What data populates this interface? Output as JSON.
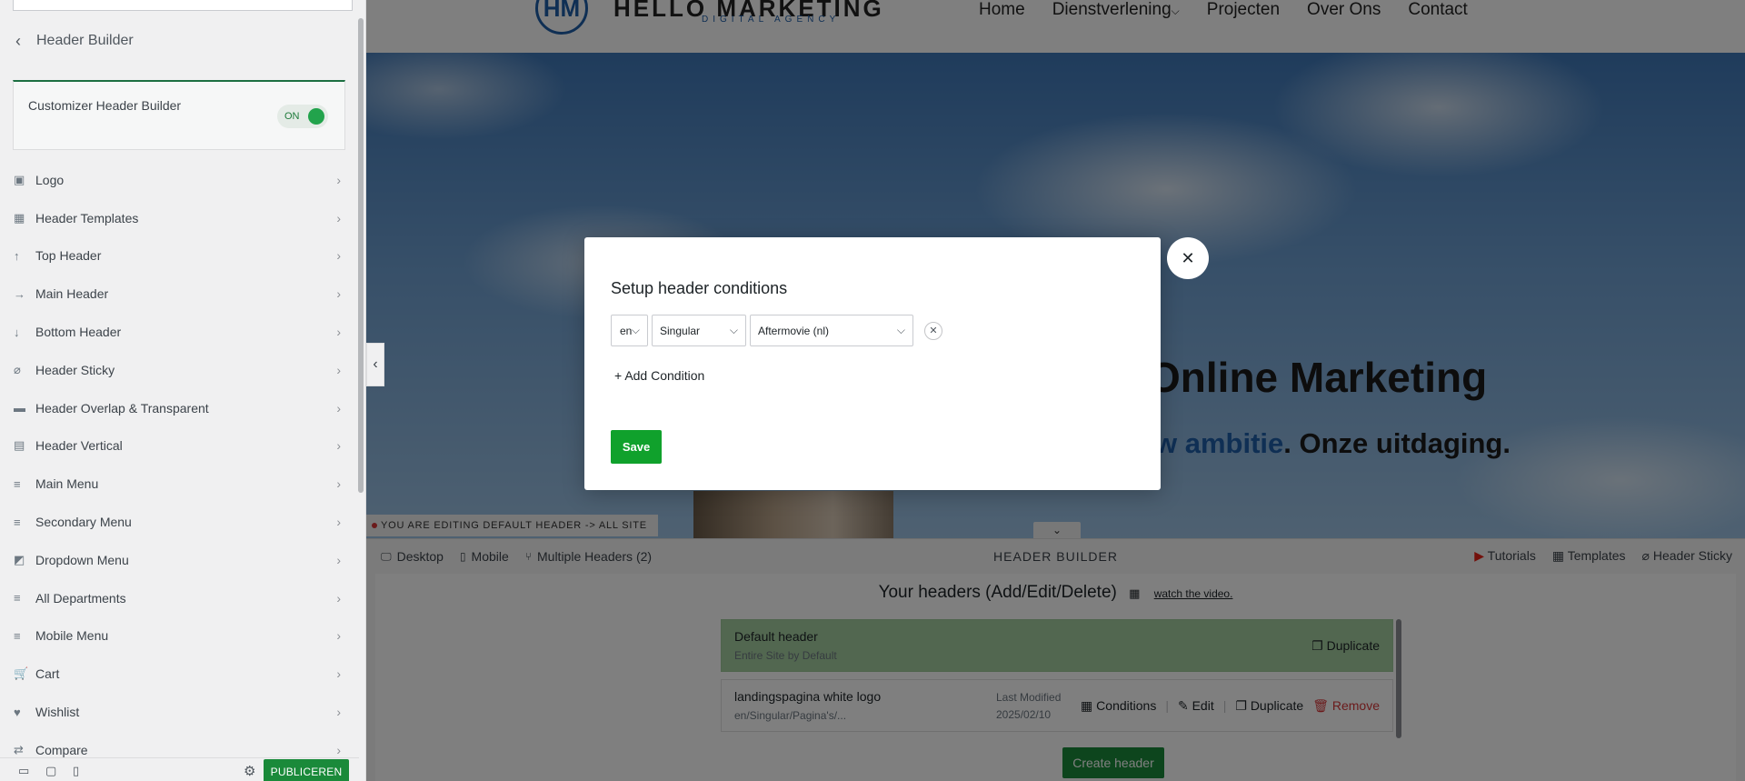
{
  "sidebar": {
    "back_title": "Header Builder",
    "toggle": {
      "label": "Customizer Header Builder",
      "state": "ON"
    },
    "items": [
      {
        "label": "Logo",
        "icon": "image-icon",
        "glyph": "▣"
      },
      {
        "label": "Header Templates",
        "icon": "grid-icon",
        "glyph": "▦"
      },
      {
        "label": "Top Header",
        "icon": "arrow-up-icon",
        "glyph": "↑"
      },
      {
        "label": "Main Header",
        "icon": "arrow-right-icon",
        "glyph": "→"
      },
      {
        "label": "Bottom Header",
        "icon": "arrow-down-icon",
        "glyph": "↓"
      },
      {
        "label": "Header Sticky",
        "icon": "paperclip-icon",
        "glyph": "⌀"
      },
      {
        "label": "Header Overlap & Transparent",
        "icon": "layers-icon",
        "glyph": "▬"
      },
      {
        "label": "Header Vertical",
        "icon": "document-icon",
        "glyph": "▤"
      },
      {
        "label": "Main Menu",
        "icon": "menu-icon",
        "glyph": "≡"
      },
      {
        "label": "Secondary Menu",
        "icon": "menu-icon",
        "glyph": "≡"
      },
      {
        "label": "Dropdown Menu",
        "icon": "dropdown-icon",
        "glyph": "◩"
      },
      {
        "label": "All Departments",
        "icon": "menu-icon",
        "glyph": "≡"
      },
      {
        "label": "Mobile Menu",
        "icon": "menu-icon",
        "glyph": "≡"
      },
      {
        "label": "Cart",
        "icon": "cart-icon",
        "glyph": "🛒"
      },
      {
        "label": "Wishlist",
        "icon": "heart-icon",
        "glyph": "♥"
      },
      {
        "label": "Compare",
        "icon": "compare-icon",
        "glyph": "⇄"
      }
    ],
    "footer": {
      "publish_label": "PUBLICEREN"
    }
  },
  "site": {
    "logo_mark": "HM",
    "logo_text": "HELLO MARKETING",
    "logo_sub": "DIGITAL AGENCY",
    "nav": [
      "Home",
      "Dienstverlening",
      "Projecten",
      "Over Ons",
      "Contact"
    ],
    "nav_dropdown_marker": "⌵",
    "hero_title": "Online Marketing",
    "hero_sub_accent": "w ambitie",
    "hero_sub_rest": ". Onze uitdaging."
  },
  "editing_notice": "YOU ARE EDITING DEFAULT HEADER -> ALL SITE",
  "builder": {
    "tabs": [
      {
        "label": "Desktop",
        "icon": "desktop-icon",
        "glyph": "🖵"
      },
      {
        "label": "Mobile",
        "icon": "mobile-icon",
        "glyph": "▯"
      },
      {
        "label": "Multiple Headers (2)",
        "icon": "branch-icon",
        "glyph": "⑂"
      }
    ],
    "title": "HEADER BUILDER",
    "links": [
      {
        "label": "Tutorials",
        "icon": "youtube-icon",
        "glyph": "▶"
      },
      {
        "label": "Templates",
        "icon": "grid-icon",
        "glyph": "▦"
      },
      {
        "label": "Header Sticky",
        "icon": "paperclip-icon",
        "glyph": "⌀"
      }
    ],
    "heading": "Your headers (Add/Edit/Delete)",
    "watch_link": "watch the video.",
    "headers": [
      {
        "name": "Default header",
        "sub": "Entire Site by Default",
        "duplicate": "Duplicate"
      },
      {
        "name": "landingspagina white logo",
        "sub": "en/Singular/Pagina's/...",
        "modified_label": "Last Modified",
        "modified_date": "2025/02/10",
        "conditions": "Conditions",
        "edit": "Edit",
        "duplicate": "Duplicate",
        "remove": "Remove"
      }
    ],
    "create_label": "Create header"
  },
  "modal": {
    "title": "Setup header conditions",
    "lang_value": "en",
    "type_value": "Singular",
    "item_value": "Aftermovie (nl)",
    "add_label": "Add Condition",
    "save_label": "Save"
  },
  "colors": {
    "accent_green": "#10a12c",
    "publish_green": "#1a8a3a",
    "brand_blue": "#1f5fa8",
    "remove_red": "#d63638"
  }
}
